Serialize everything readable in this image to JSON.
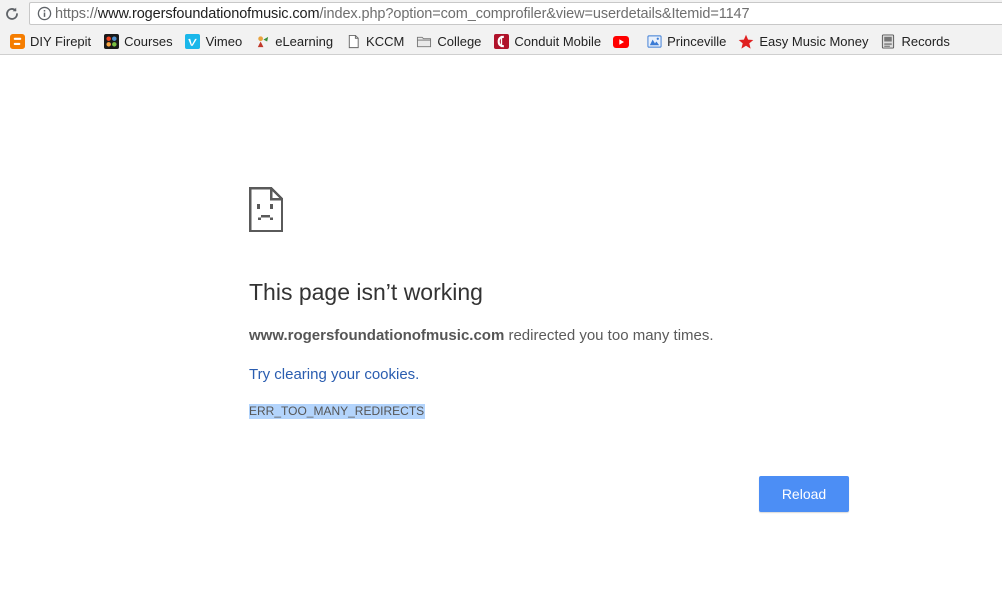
{
  "browser": {
    "url_prefix": "https://",
    "url_host": "www.rogersfoundationofmusic.com",
    "url_path": "/index.php?option=com_comprofiler&view=userdetails&Itemid=1147"
  },
  "bookmarks": [
    {
      "label": "DIY Firepit",
      "icon": "blogger-icon",
      "color": "#f57d00"
    },
    {
      "label": "Courses",
      "icon": "joomla-icon",
      "color": "#1a1a1a"
    },
    {
      "label": "Vimeo",
      "icon": "vimeo-icon",
      "color": "#1ab7ea"
    },
    {
      "label": "eLearning",
      "icon": "elearning-icon",
      "color": "#e8a33d"
    },
    {
      "label": "KCCM",
      "icon": "page-icon",
      "color": "#666666"
    },
    {
      "label": "College",
      "icon": "folder-icon",
      "color": "#7a7a7a"
    },
    {
      "label": "Conduit Mobile",
      "icon": "conduit-icon",
      "color": "#b0122a"
    },
    {
      "label": "",
      "icon": "youtube-icon",
      "color": "#ff0000"
    },
    {
      "label": "Princeville",
      "icon": "princeville-icon",
      "color": "#3a7bd5"
    },
    {
      "label": "Easy Music Money",
      "icon": "star-icon",
      "color": "#e02020"
    },
    {
      "label": "Records",
      "icon": "records-icon",
      "color": "#555555"
    }
  ],
  "error": {
    "title": "This page isn’t working",
    "host": "www.rogersfoundationofmusic.com",
    "desc_suffix": " redirected you too many times.",
    "link_text": "Try clearing your cookies.",
    "code": "ERR_TOO_MANY_REDIRECTS",
    "reload_label": "Reload"
  },
  "colors": {
    "accent": "#4c8ef5",
    "link": "#2a5db0",
    "selection": "#b3d4fc"
  }
}
